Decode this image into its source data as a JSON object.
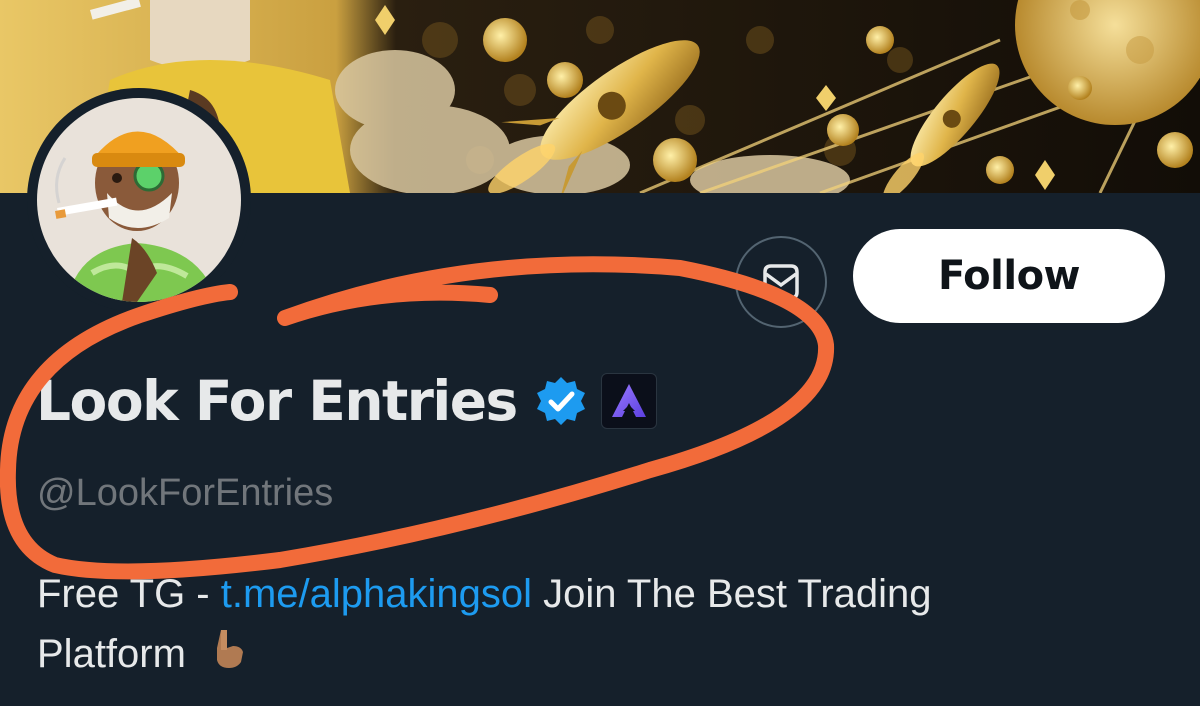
{
  "profile": {
    "display_name": "Look For Entries",
    "handle": "@LookForEntries",
    "verified": true,
    "affiliate_badge_icon": "affiliate-a-logo-icon"
  },
  "actions": {
    "message_icon": "envelope-icon",
    "follow_label": "Follow"
  },
  "bio": {
    "prefix": "Free TG - ",
    "link": "t.me/alphakingsol",
    "line1_suffix": " Join The Best Trading",
    "line2": "Platform",
    "emoji_icon": "backhand-index-pointing-down-icon"
  },
  "colors": {
    "background": "#15202b",
    "link": "#1d9bf0",
    "verified": "#1d9bf0",
    "annotation": "#f26b3a",
    "banner_gold": "#d4a83a"
  }
}
